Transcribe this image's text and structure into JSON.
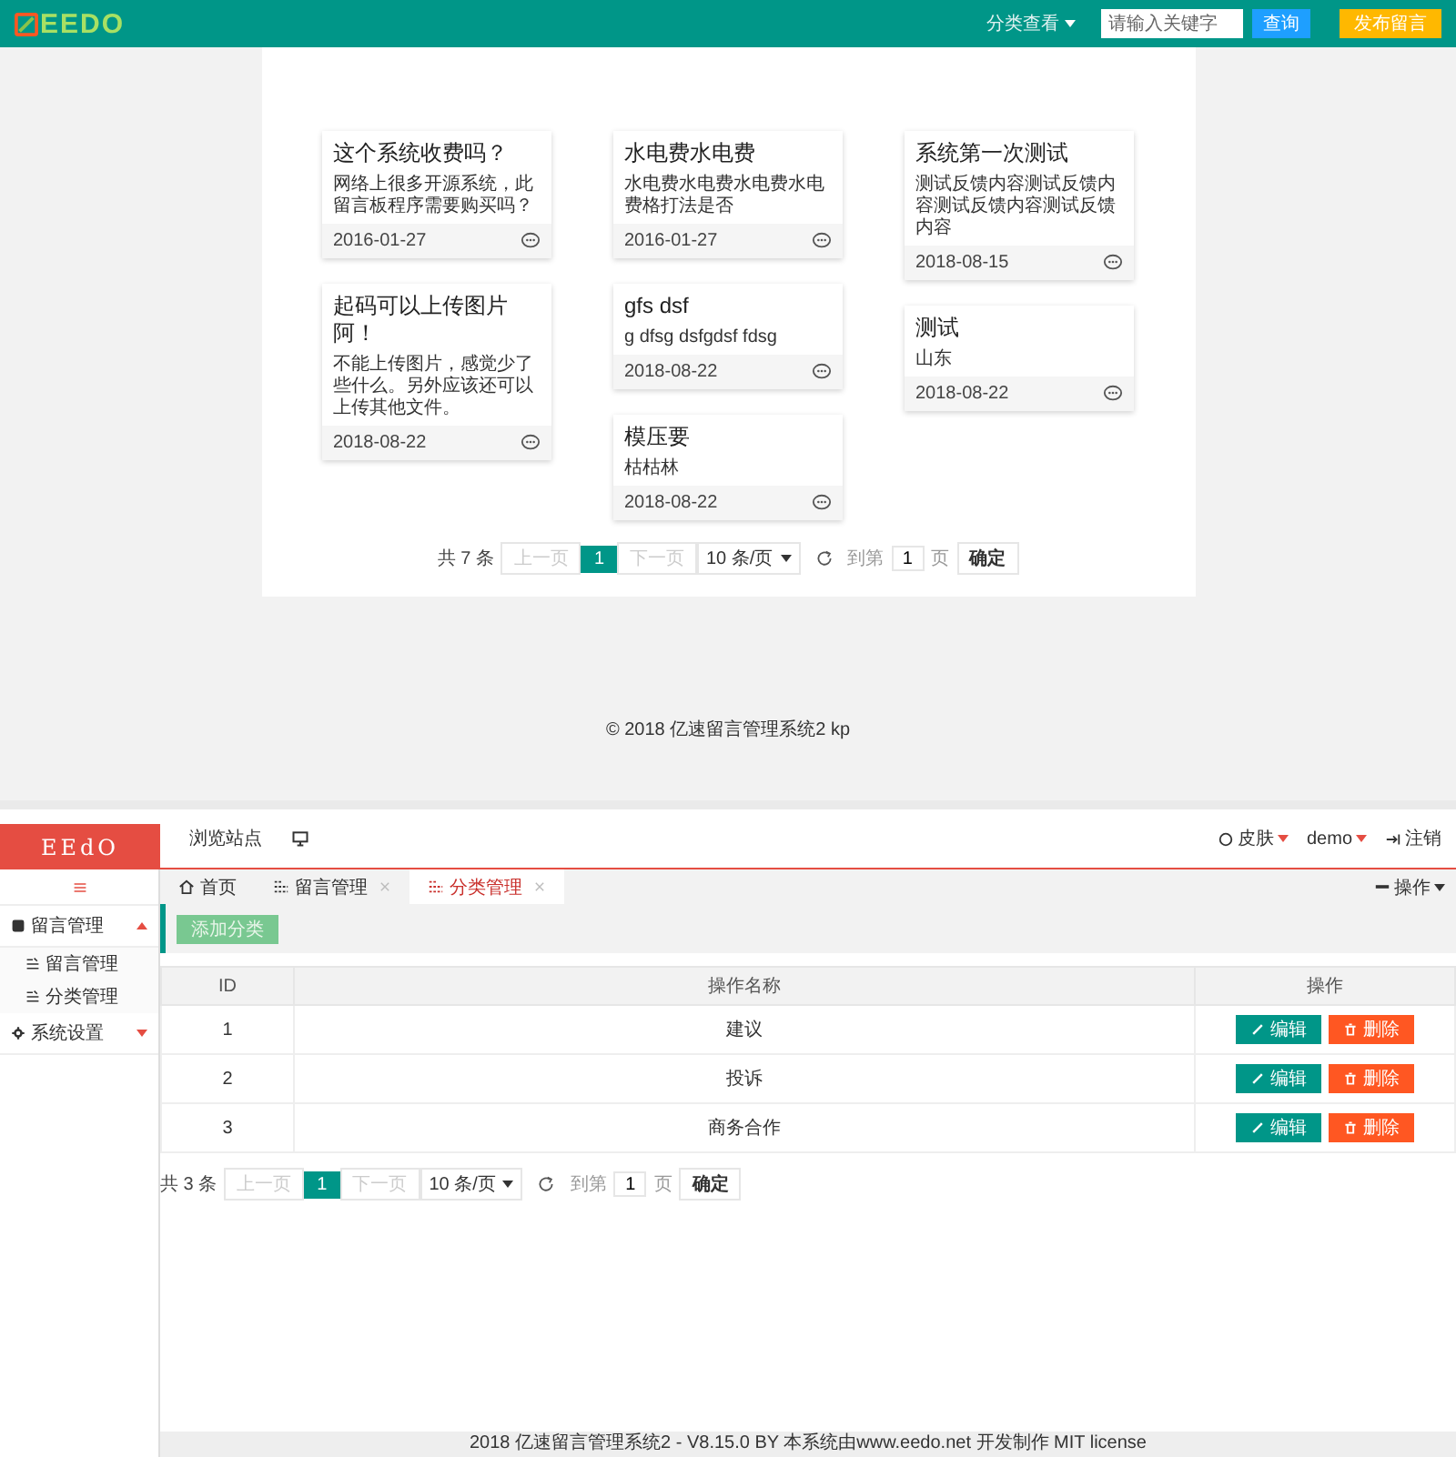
{
  "front": {
    "logo": "EEDO",
    "nav": {
      "label": "分类查看"
    },
    "search": {
      "placeholder": "请输入关键字"
    },
    "search_button": "查询",
    "post_button": "发布留言",
    "columns": [
      [
        {
          "title": "这个系统收费吗？",
          "body": "网络上很多开源系统，此留言板程序需要购买吗？",
          "date": "2016-01-27"
        },
        {
          "title": "起码可以上传图片阿！",
          "body": "不能上传图片，感觉少了些什么。另外应该还可以上传其他文件。",
          "date": "2018-08-22"
        }
      ],
      [
        {
          "title": "水电费水电费",
          "body": "水电费水电费水电费水电费格打法是否",
          "date": "2016-01-27"
        },
        {
          "title": "gfs dsf",
          "body": "g dfsg dsfgdsf fdsg",
          "date": "2018-08-22"
        },
        {
          "title": "模压要",
          "body": "枯枯林",
          "date": "2018-08-22"
        }
      ],
      [
        {
          "title": "系统第一次测试",
          "body": "测试反馈内容测试反馈内容测试反馈内容测试反馈内容",
          "date": "2018-08-15"
        },
        {
          "title": "测试",
          "body": "山东",
          "date": "2018-08-22"
        }
      ]
    ],
    "pagination": {
      "total": "共 7 条",
      "prev": "上一页",
      "pages": [
        {
          "label": "1",
          "selected": true
        }
      ],
      "next": "下一页",
      "page_size": "10 条/页",
      "goto": "到第",
      "page_value": "1",
      "page_unit": "页",
      "confirm": "确定"
    },
    "footer": "© 2018 亿速留言管理系统2  kp"
  },
  "admin": {
    "logo": "EEdO",
    "top_link": "浏览站点",
    "skin": "皮肤",
    "user": "demo",
    "logout": "注销",
    "sidebar": [
      {
        "label": "留言管理",
        "expanded": true,
        "children": [
          {
            "label": "留言管理"
          },
          {
            "label": "分类管理"
          }
        ]
      },
      {
        "label": "系统设置",
        "expanded": false
      }
    ],
    "tabs": [
      {
        "label": "首页",
        "selected": false,
        "kind": "home"
      },
      {
        "label": "留言管理",
        "selected": false,
        "kind": "page"
      },
      {
        "label": "分类管理",
        "selected": true,
        "kind": "page"
      }
    ],
    "tab_ops": "操作",
    "add_button": "添加分类",
    "table": {
      "columns": [
        "ID",
        "操作名称",
        "操作"
      ],
      "rows": [
        {
          "id": "1",
          "name": "建议",
          "edit": "编辑",
          "delete": "删除"
        },
        {
          "id": "2",
          "name": "投诉",
          "edit": "编辑",
          "delete": "删除"
        },
        {
          "id": "3",
          "name": "商务合作",
          "edit": "编辑",
          "delete": "删除"
        }
      ]
    },
    "pagination": {
      "total": "共 3 条",
      "prev": "上一页",
      "pages": [
        {
          "label": "1",
          "selected": true
        }
      ],
      "next": "下一页",
      "page_size": "10 条/页",
      "goto": "到第",
      "page_value": "1",
      "page_unit": "页",
      "confirm": "确定"
    },
    "footer": "2018    亿速留言管理系统2 - V8.15.0 BY 本系统由www.eedo.net 开发制作 MIT license"
  }
}
